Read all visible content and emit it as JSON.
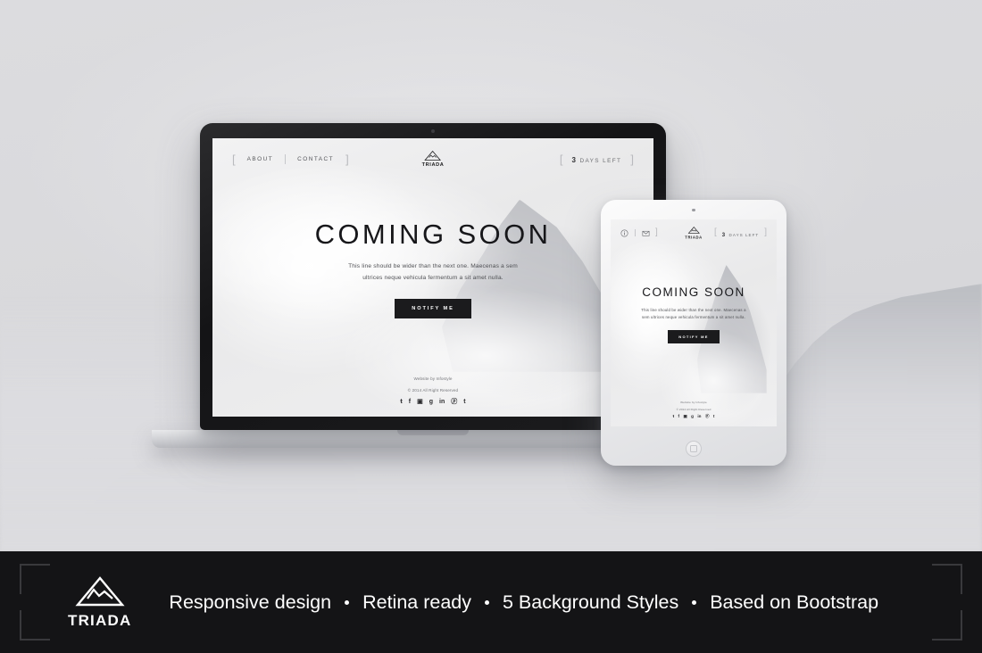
{
  "background": {
    "color": "#dcdcdf",
    "mountain_color": "#b9bbc0"
  },
  "website": {
    "nav": [
      {
        "label": "About",
        "name": "about"
      },
      {
        "label": "Contact",
        "name": "contact"
      }
    ],
    "brand": {
      "name": "TRIADA",
      "mark_icon": "mountain-triangle-icon"
    },
    "countdown": {
      "number": "3",
      "label": "Days Left"
    },
    "hero": {
      "title": "COMING SOON",
      "subtitle": "This line should be wider than the next one. Maecenas a sem ultrices neque vehicula fermentum a sit amet nulla.",
      "button": "Notify Me"
    },
    "footer": {
      "credit_line1": "Website by Infostyle",
      "credit_line2": "© 2014 All Right Reserved",
      "socials": [
        {
          "name": "twitter-icon",
          "glyph": "ŧ"
        },
        {
          "name": "facebook-icon",
          "glyph": "f"
        },
        {
          "name": "instagram-icon",
          "glyph": "▣"
        },
        {
          "name": "googleplus-icon",
          "glyph": "g"
        },
        {
          "name": "linkedin-icon",
          "glyph": "in"
        },
        {
          "name": "pinterest-icon",
          "glyph": "ⓟ"
        },
        {
          "name": "tumblr-icon",
          "glyph": "t"
        }
      ]
    },
    "tablet_header_icons": [
      {
        "name": "info-icon"
      },
      {
        "name": "envelope-icon"
      }
    ]
  },
  "banner": {
    "brand_name": "TRIADA",
    "brand_icon": "mountain-triangle-icon",
    "features": [
      "Responsive design",
      "Retina ready",
      "5 Background Styles",
      "Based on Bootstrap"
    ],
    "background": "#141416",
    "text_color": "#ffffff"
  }
}
